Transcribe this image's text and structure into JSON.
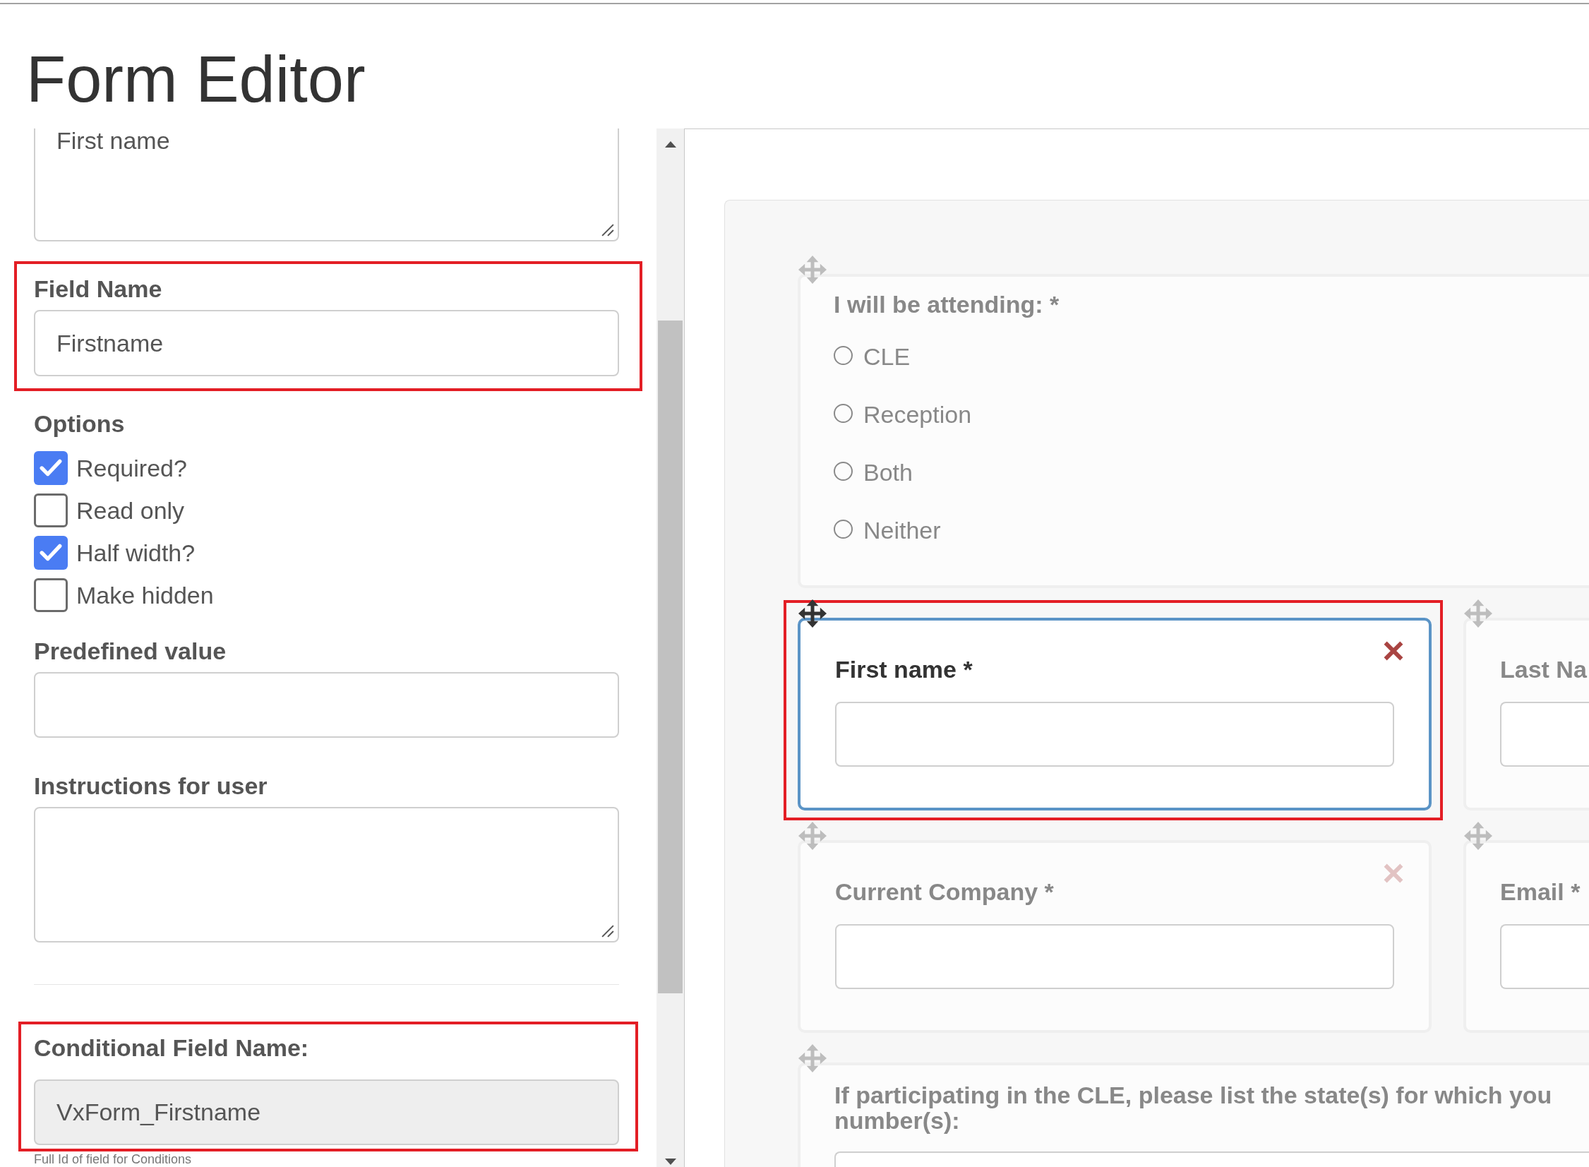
{
  "page": {
    "title": "Form Editor"
  },
  "settings_panel": {
    "top_textarea": {
      "value": "First name"
    },
    "field_name": {
      "label": "Field Name",
      "value": "Firstname",
      "highlighted": true
    },
    "options": {
      "label": "Options",
      "items": [
        {
          "label": "Required?",
          "checked": true
        },
        {
          "label": "Read only",
          "checked": false
        },
        {
          "label": "Half width?",
          "checked": true
        },
        {
          "label": "Make hidden",
          "checked": false
        }
      ]
    },
    "predefined_value": {
      "label": "Predefined value",
      "highlighted": false
    },
    "instructions": {
      "label": "Instructions for user",
      "highlighted": false
    },
    "conditional_field_name": {
      "label": "Conditional Field Name:",
      "value": "VxForm_Firstname",
      "readonly": true,
      "highlighted": true,
      "hint": "Full Id of field for Conditions"
    }
  },
  "form_canvas": {
    "rows": [
      {
        "cards": [
          {
            "kind": "radio",
            "label": "I will be attending: *",
            "selected": false,
            "highlighted": false,
            "options": [
              {
                "label": "CLE",
                "selected": false
              },
              {
                "label": "Reception",
                "selected": false
              },
              {
                "label": "Both",
                "selected": false
              },
              {
                "label": "Neither",
                "selected": false
              }
            ]
          }
        ]
      },
      {
        "cards": [
          {
            "kind": "text",
            "label": "First name *",
            "selected": true,
            "highlighted": true
          },
          {
            "kind": "text",
            "label": "Last Na",
            "selected": false,
            "highlighted": false
          }
        ]
      },
      {
        "cards": [
          {
            "kind": "text",
            "label": "Current Company *",
            "selected": false,
            "highlighted": false
          },
          {
            "kind": "text",
            "label": "Email *",
            "selected": false,
            "highlighted": false
          }
        ]
      },
      {
        "cards": [
          {
            "kind": "text",
            "label_lines": [
              "If participating in the CLE, please list the state(s) for which you",
              "number(s):"
            ],
            "selected": false,
            "highlighted": false
          }
        ]
      }
    ]
  }
}
